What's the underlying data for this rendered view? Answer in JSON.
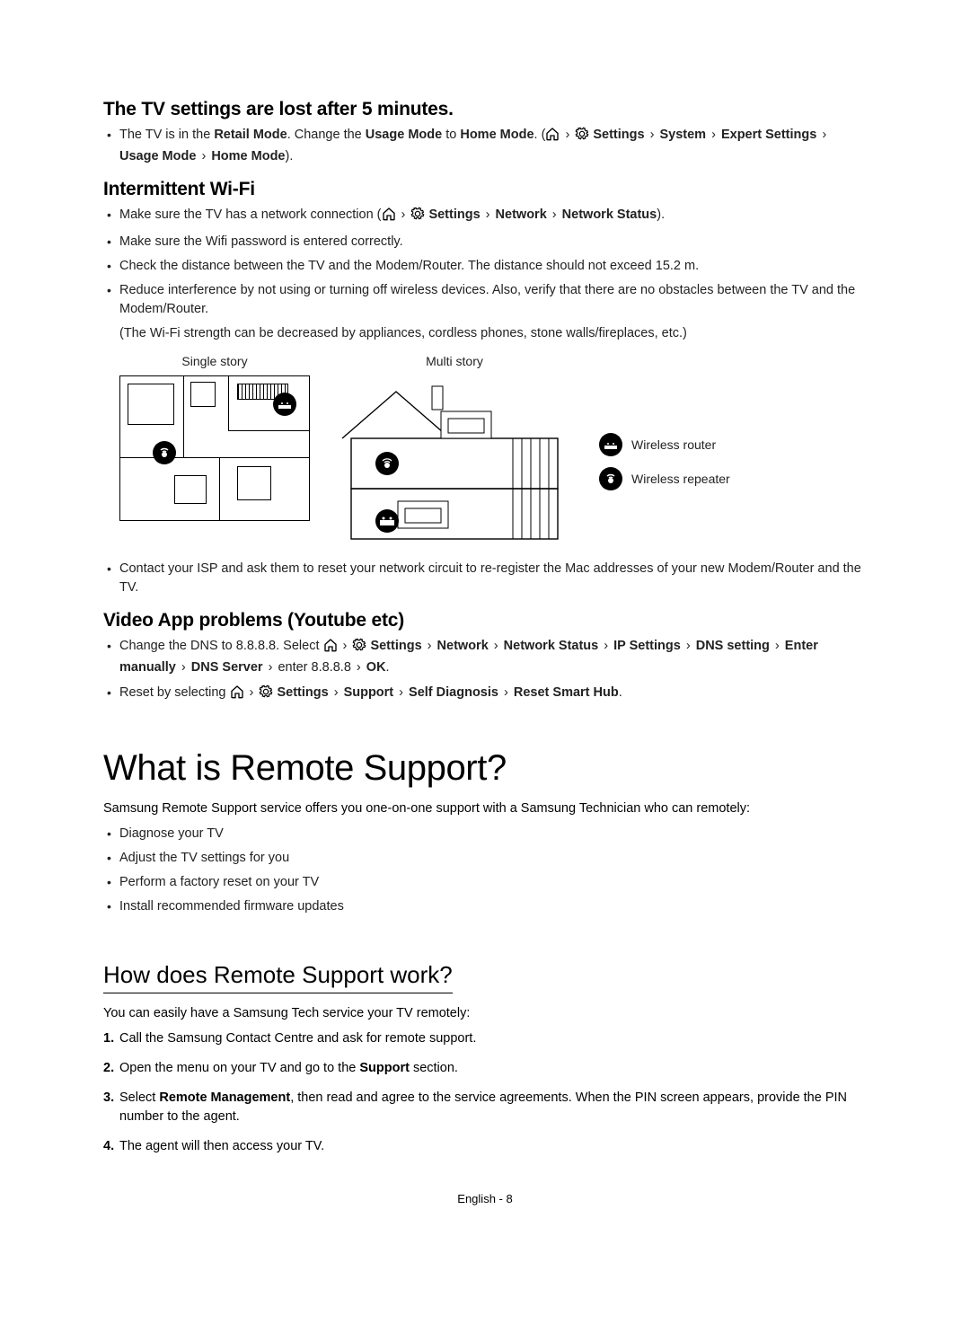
{
  "s1": {
    "heading": "The TV settings are lost after 5 minutes.",
    "bullet1_pre": "The TV is in the ",
    "retail": "Retail Mode",
    "bullet1_mid": ". Change the ",
    "usage": "Usage Mode",
    "to": " to ",
    "home": "Home Mode",
    "bullet1_post": ". (",
    "gt": "›",
    "settings": "Settings",
    "system": "System",
    "expert": "Expert Settings",
    "usage2": "Usage Mode",
    "home2": "Home Mode",
    "bullet1_end": ")."
  },
  "wifi": {
    "heading": "Intermittent Wi-Fi",
    "b1_pre": "Make sure the TV has a network connection (",
    "settings": "Settings",
    "network": "Network",
    "netstatus": "Network Status",
    "b1_end": ").",
    "b2": "Make sure the Wifi password is entered correctly.",
    "b3": "Check the distance between the TV and the Modem/Router. The distance should not exceed 15.2 m.",
    "b4": "Reduce interference by not using or turning off wireless devices. Also, verify that there are no obstacles between the TV and the Modem/Router.",
    "b4_note": "(The Wi-Fi strength can be decreased by appliances, cordless phones, stone walls/fireplaces, etc.)",
    "cap_single": "Single story",
    "cap_multi": "Multi story",
    "legend_router": "Wireless router",
    "legend_repeater": "Wireless repeater",
    "b5": "Contact your ISP and ask them to reset your network circuit to re-register the Mac addresses of your new Modem/Router and the TV."
  },
  "video": {
    "heading": "Video App problems (Youtube etc)",
    "b1_pre": "Change the DNS to 8.8.8.8. Select ",
    "settings": "Settings",
    "network": "Network",
    "netstatus": "Network Status",
    "ipsettings": "IP Settings",
    "dnssetting": "DNS setting",
    "enterman": "Enter manually",
    "dnsserver": "DNS Server",
    "enter": " enter 8.8.8.8 ",
    "ok": "OK",
    "b2_pre": "Reset by selecting ",
    "support": "Support",
    "selfdiag": "Self Diagnosis",
    "resetsmart": "Reset Smart Hub"
  },
  "remote": {
    "heading": "What is Remote Support?",
    "lead": "Samsung Remote Support service offers you one-on-one support with a Samsung Technician who can remotely:",
    "b1": "Diagnose your TV",
    "b2": "Adjust the TV settings for you",
    "b3": "Perform a factory reset on your TV",
    "b4": "Install recommended firmware updates"
  },
  "how": {
    "heading": "How does Remote Support work?",
    "lead": "You can easily have a Samsung Tech service your TV remotely:",
    "s1": "Call the Samsung Contact Centre and ask for remote support.",
    "s2_pre": "Open the menu on your TV and go to the ",
    "s2_bold": "Support",
    "s2_post": " section.",
    "s3_pre": "Select ",
    "s3_bold": "Remote Management",
    "s3_post": ", then read and agree to the service agreements. When the PIN screen appears, provide the PIN number to the agent.",
    "s4": "The agent will then access your TV."
  },
  "footer": "English - 8"
}
